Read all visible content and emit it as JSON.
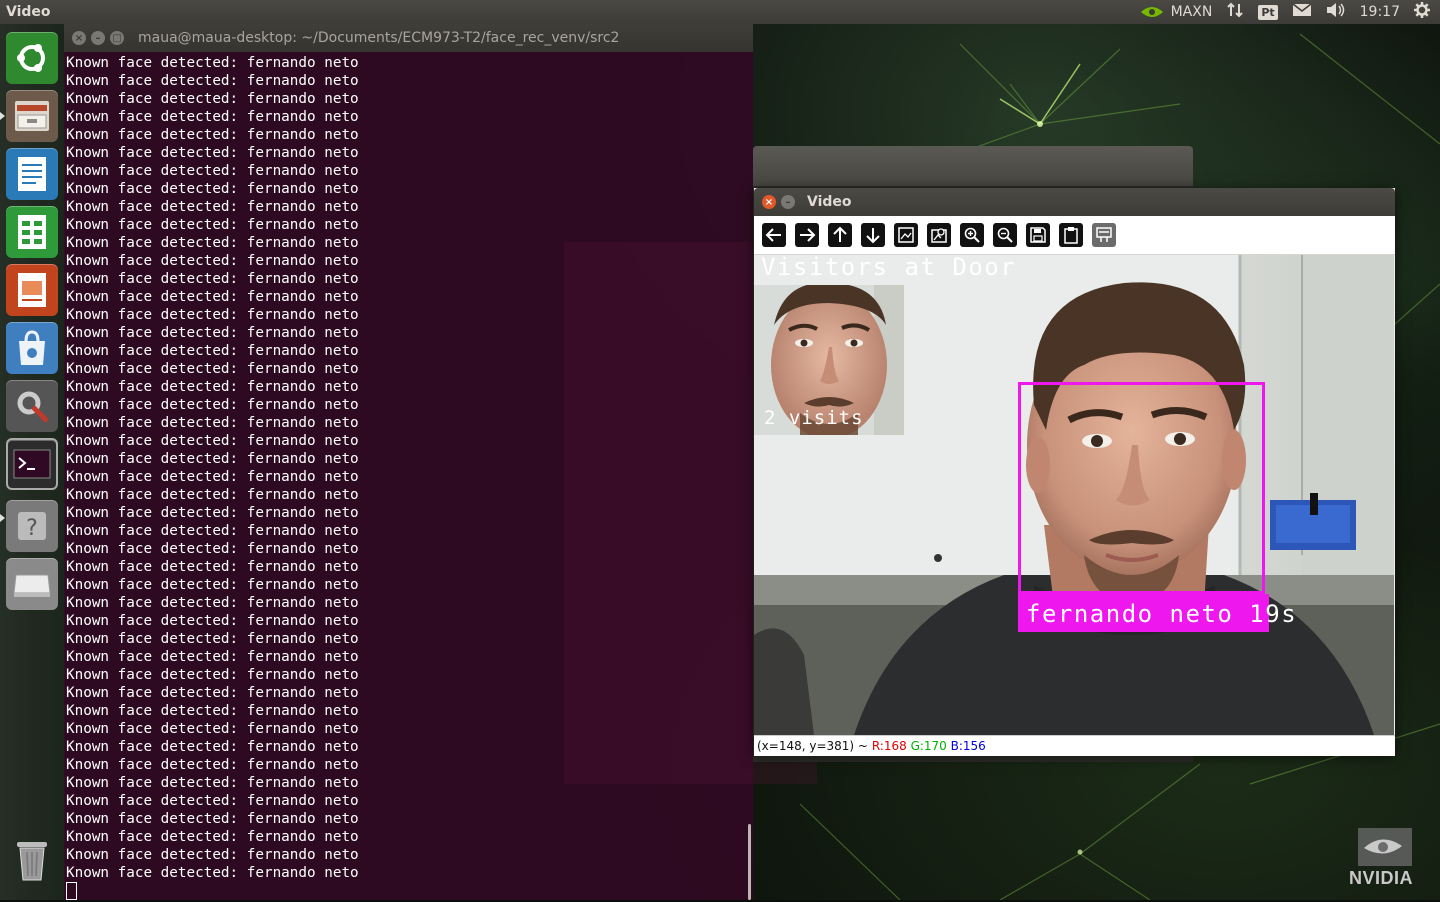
{
  "top_panel": {
    "app_title": "Video",
    "gpu_mode": "MAXN",
    "keyboard_layout": "Pt",
    "clock": "19:17"
  },
  "launcher": {
    "items": [
      {
        "name": "ubuntu-dash",
        "color": "#2f8a2f"
      },
      {
        "name": "file-manager",
        "color": "#6e5a4a"
      },
      {
        "name": "libreoffice-writer",
        "color": "#2a7ab8"
      },
      {
        "name": "libreoffice-calc",
        "color": "#2f9a3a"
      },
      {
        "name": "libreoffice-impress",
        "color": "#c2441e"
      },
      {
        "name": "software-center",
        "color": "#3f7fc0"
      },
      {
        "name": "system-settings",
        "color": "#555555"
      },
      {
        "name": "terminal",
        "color": "#2c2c2c"
      },
      {
        "name": "help",
        "color": "#7a7a7a"
      },
      {
        "name": "drive",
        "color": "#8a8a8a"
      },
      {
        "name": "trash",
        "color": "#5a5a5a"
      }
    ]
  },
  "terminal": {
    "title": "maua@maua-desktop: ~/Documents/ECM973-T2/face_rec_venv/src2",
    "line_text": "Known face detected: fernando neto",
    "line_count": 46
  },
  "video_window": {
    "title": "Video",
    "toolbar": [
      {
        "icon": "arrow-left-icon"
      },
      {
        "icon": "arrow-right-icon"
      },
      {
        "icon": "arrow-up-icon"
      },
      {
        "icon": "arrow-down-icon"
      },
      {
        "icon": "zoom-fit-icon"
      },
      {
        "icon": "zoom-original-icon"
      },
      {
        "icon": "zoom-in-icon"
      },
      {
        "icon": "zoom-out-icon"
      },
      {
        "icon": "save-icon"
      },
      {
        "icon": "copy-clipboard-icon"
      },
      {
        "icon": "properties-icon"
      }
    ],
    "overlay_title": "Visitors at Door",
    "visit_label": "2 visits",
    "face_label": "fernando neto 19s",
    "box_color": "#ee18ee",
    "status": {
      "coords": "(x=148, y=381) ~",
      "r": "R:168",
      "g": "G:170",
      "b": "B:156"
    }
  },
  "branding": {
    "vendor": "NVIDIA"
  }
}
